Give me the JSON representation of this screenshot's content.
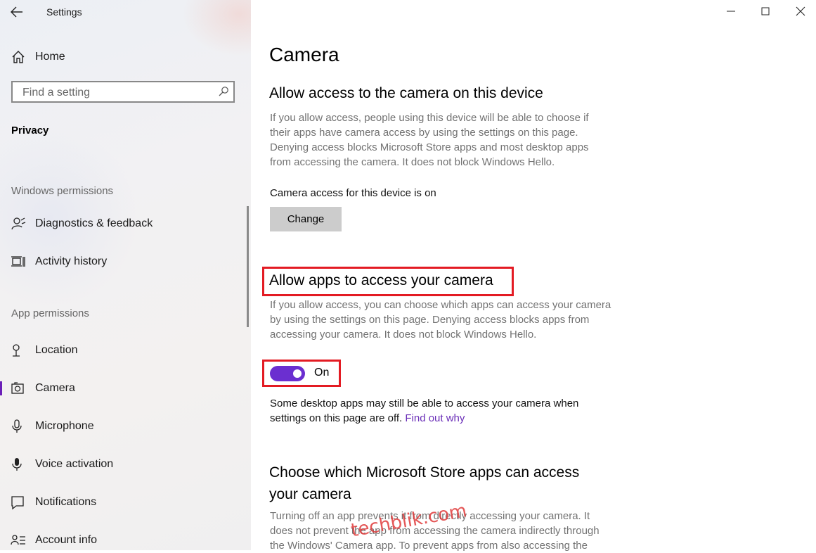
{
  "window": {
    "title": "Settings",
    "controls": {
      "minimize": "minimize-icon",
      "maximize": "maximize-icon",
      "close": "close-icon"
    }
  },
  "sidebar": {
    "home_label": "Home",
    "search_placeholder": "Find a setting",
    "category": "Privacy",
    "section_windows": "Windows permissions",
    "windows_items": [
      {
        "label": "Diagnostics & feedback",
        "icon": "diagnostics-icon"
      },
      {
        "label": "Activity history",
        "icon": "activity-history-icon"
      }
    ],
    "section_app": "App permissions",
    "app_items": [
      {
        "label": "Location",
        "icon": "location-icon"
      },
      {
        "label": "Camera",
        "icon": "camera-icon",
        "selected": true
      },
      {
        "label": "Microphone",
        "icon": "microphone-icon"
      },
      {
        "label": "Voice activation",
        "icon": "voice-activation-icon"
      },
      {
        "label": "Notifications",
        "icon": "notifications-icon"
      },
      {
        "label": "Account info",
        "icon": "account-info-icon"
      }
    ]
  },
  "main": {
    "title": "Camera",
    "device_section": {
      "heading": "Allow access to the camera on this device",
      "desc_lines": [
        "If you allow access, people using this device will be able to choose if",
        "their apps have camera access by using the settings on this page.",
        "Denying access blocks Microsoft Store apps and most desktop apps",
        "from accessing the camera. It does not block Windows Hello."
      ],
      "status": "Camera access for this device is on",
      "change_label": "Change"
    },
    "apps_section": {
      "heading": "Allow apps to access your camera",
      "desc_lines": [
        "If you allow access, you can choose which apps can access your camera",
        "by using the settings on this page. Denying access blocks apps from",
        "accessing your camera. It does not block Windows Hello."
      ],
      "toggle_state": "On",
      "toggle_on": true,
      "note_line1": "Some desktop apps may still be able to access your camera when",
      "note_line2": "settings on this page are off.",
      "note_link": "Find out why"
    },
    "store_section": {
      "heading_line1": "Choose which Microsoft Store apps can access",
      "heading_line2": "your camera",
      "desc_lines": [
        "Turning off an app prevents it from directly accessing your camera. It",
        "does not prevent the app from accessing the camera indirectly through",
        "the Windows' Camera app. To prevent apps from also accessing the"
      ]
    },
    "watermark": "techblik.com"
  },
  "colors": {
    "accent": "#6b2fd0",
    "highlight": "#e31b23",
    "link": "#6b2fb8",
    "muted_text": "#727272"
  }
}
